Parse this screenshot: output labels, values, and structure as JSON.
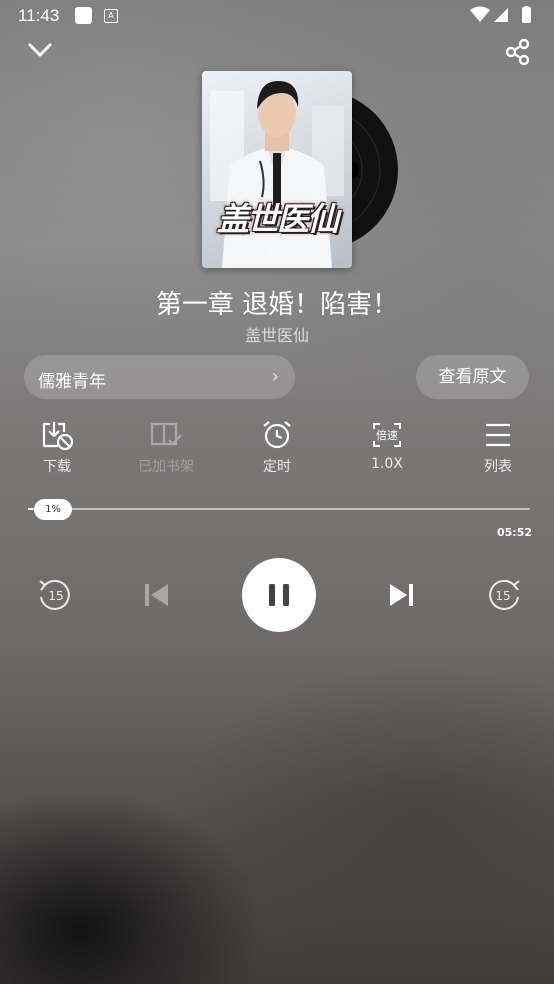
{
  "status_bar": {
    "time": "11:43",
    "notification_badge": "A"
  },
  "cover": {
    "title": "盖世医仙",
    "author": "八月初八 著"
  },
  "chapter_title": "第一章 退婚！陷害！",
  "book_name": "盖世医仙",
  "narrator": {
    "label": "儒雅青年",
    "chevron": "›"
  },
  "view_original_label": "查看原文",
  "actions": [
    {
      "label": "下载",
      "icon": "download-icon",
      "enabled": true
    },
    {
      "label": "已加书架",
      "icon": "bookshelf-icon",
      "enabled": false
    },
    {
      "label": "定时",
      "icon": "alarm-icon",
      "enabled": true
    },
    {
      "label": "1.0X",
      "icon": "speed-icon",
      "icon_text": "倍速",
      "enabled": true
    },
    {
      "label": "列表",
      "icon": "list-icon",
      "enabled": true
    }
  ],
  "progress": {
    "percent_label": "1%",
    "fraction": 0.01,
    "duration": "05:52"
  },
  "controls": {
    "rewind_seconds": "15",
    "forward_seconds": "15",
    "state": "playing"
  }
}
